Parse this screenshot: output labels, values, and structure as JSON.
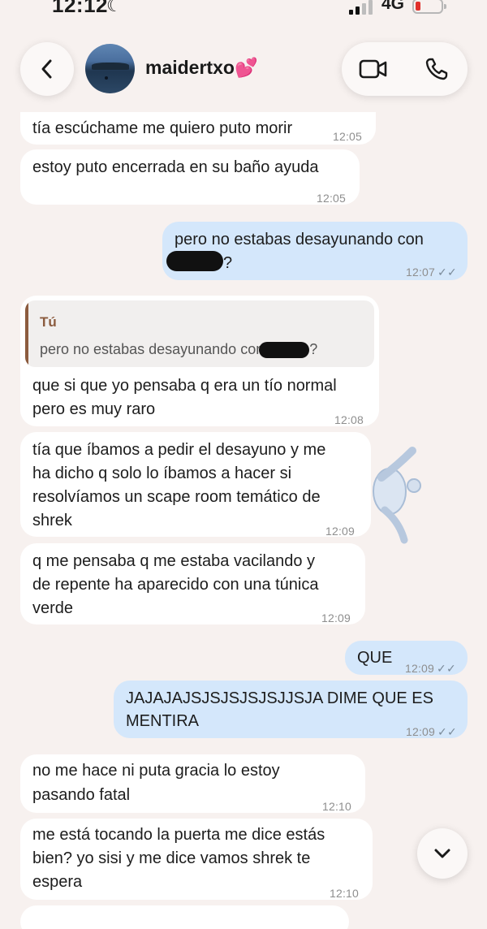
{
  "status_bar": {
    "time": "12:12",
    "moon_icon": "☾",
    "network": "4G",
    "battery_color": "#e0302b"
  },
  "header": {
    "contact_name": "maidertxo",
    "name_emoji": "💕",
    "back_icon": "chevron-left-icon",
    "video_icon": "video-camera-icon",
    "call_icon": "phone-icon"
  },
  "colors": {
    "incoming_bubble": "#ffffff",
    "outgoing_bubble": "#d4e7fb",
    "background": "#f7f1ef",
    "reply_accent": "#8b5b3e"
  },
  "messages": [
    {
      "direction": "in",
      "lines": [
        "tía escúchame me quiero puto morir"
      ],
      "time": "12:05"
    },
    {
      "direction": "in",
      "lines": [
        "estoy puto encerrada en su baño ayuda"
      ],
      "time": "12:05"
    },
    {
      "direction": "out",
      "lines": [
        "pero no estabas desayunando con",
        "?"
      ],
      "time": "12:07",
      "read": "✓✓"
    },
    {
      "direction": "in",
      "reply_author": "Tú",
      "reply_text": "pero no estabas desayunando con",
      "reply_end": "?",
      "lines": [
        "que si que yo pensaba q era un tío normal",
        "pero es muy raro"
      ],
      "time": "12:08"
    },
    {
      "direction": "in",
      "lines": [
        "tía que íbamos a pedir el desayuno y me",
        "ha dicho q solo lo íbamos a hacer si",
        "resolvíamos un scape room temático de",
        "shrek"
      ],
      "time": "12:09"
    },
    {
      "direction": "in",
      "lines": [
        "q me pensaba q me estaba vacilando y",
        "de repente ha aparecido con una túnica",
        "verde"
      ],
      "time": "12:09"
    },
    {
      "direction": "out",
      "lines": [
        "QUE"
      ],
      "time": "12:09",
      "read": "✓✓"
    },
    {
      "direction": "out",
      "lines": [
        "JAJAJAJSJSJSJSJSJJSJA DIME QUE ES",
        "MENTIRA"
      ],
      "time": "12:09",
      "read": "✓✓"
    },
    {
      "direction": "in",
      "lines": [
        "no me hace ni puta gracia lo estoy",
        "pasando fatal"
      ],
      "time": "12:10"
    },
    {
      "direction": "in",
      "lines": [
        "me está tocando la puerta me dice estás",
        "bien? yo sisi y me dice vamos shrek te",
        "espera"
      ],
      "time": "12:10"
    }
  ],
  "scroll_button_icon": "chevron-down-icon"
}
